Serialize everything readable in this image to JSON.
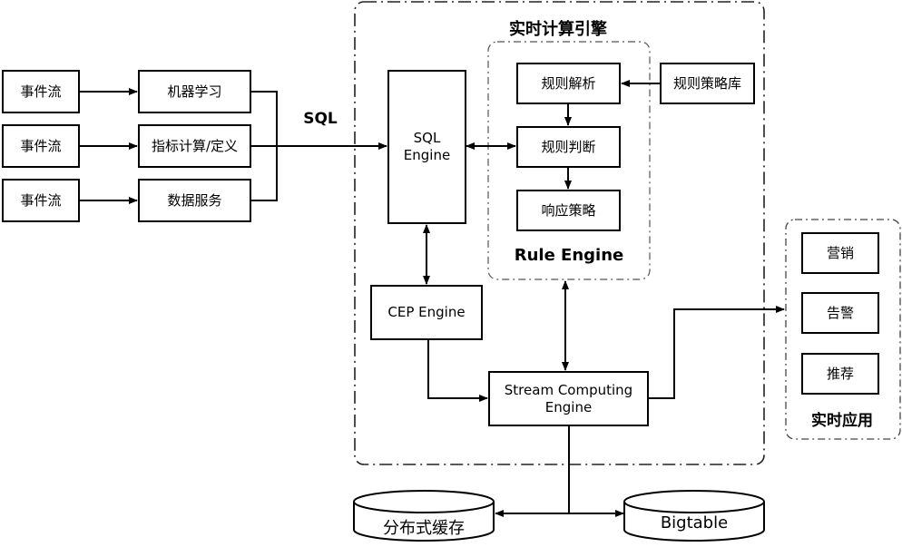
{
  "diagram": {
    "sources": [
      "事件流",
      "事件流",
      "事件流"
    ],
    "processors": [
      "机器学习",
      "指标计算/定义",
      "数据服务"
    ],
    "sql_edge_label": "SQL",
    "engine_group_title": "实时计算引擎",
    "sql_engine": {
      "line1": "SQL",
      "line2": "Engine"
    },
    "rule_engine": {
      "title": "Rule Engine",
      "steps": [
        "规则解析",
        "规则判断",
        "响应策略"
      ],
      "library": "规则策略库"
    },
    "cep_engine": "CEP Engine",
    "stream_engine": {
      "line1": "Stream Computing",
      "line2": "Engine"
    },
    "apps_group_title": "实时应用",
    "apps": [
      "营销",
      "告警",
      "推荐"
    ],
    "storage": [
      "分布式缓存",
      "Bigtable"
    ]
  }
}
